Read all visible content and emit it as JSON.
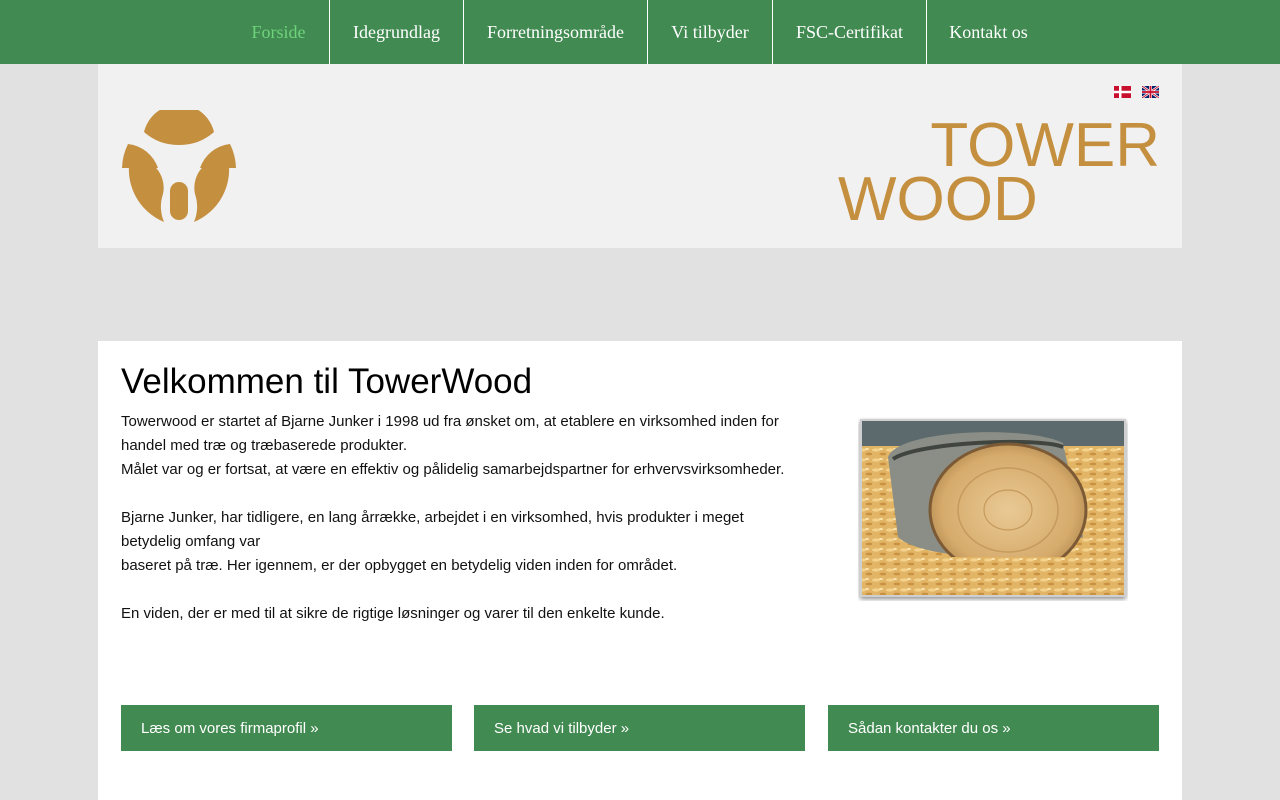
{
  "nav": {
    "items": [
      {
        "label": "Forside",
        "active": true
      },
      {
        "label": "Idegrundlag"
      },
      {
        "label": "Forretningsområde"
      },
      {
        "label": "Vi tilbyder"
      },
      {
        "label": "FSC-Certifikat"
      },
      {
        "label": "Kontakt os"
      }
    ]
  },
  "header": {
    "languages": [
      "danish-flag-icon",
      "english-flag-icon"
    ],
    "wordmark": {
      "line1": "TOWER",
      "line2": "WOOD"
    }
  },
  "main": {
    "title": "Velkommen til TowerWood",
    "paragraphs": [
      "Towerwood er startet af Bjarne Junker i 1998 ud fra ønsket om, at etablere en virksomhed inden for handel med træ og træbaserede produkter.",
      "Målet var og er fortsat, at være en effektiv og pålidelig samarbejdspartner for erhvervsvirksomheder.",
      "Bjarne Junker, har tidligere, en lang årrække, arbejdet i en virksomhed, hvis produkter i meget betydelig omfang var",
      "baseret på træ. Her igennem, er der opbygget en betydelig viden inden for området.",
      "En viden, der er med til at sikre de rigtige løsninger og varer til den enkelte kunde."
    ],
    "buttons": [
      "Læs om vores firmaprofil »",
      "Se hvad vi tilbyder »",
      "Sådan kontakter du os »"
    ]
  },
  "colors": {
    "nav_green": "#418a51",
    "active_nav": "#6fd37c",
    "brand_gold": "#c48f3e"
  }
}
